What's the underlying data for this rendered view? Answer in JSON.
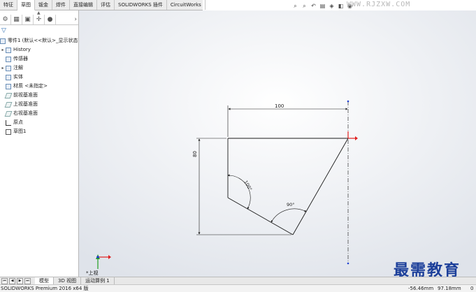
{
  "command_tabs": [
    "特征",
    "草图",
    "钣金",
    "焊件",
    "直接编辑",
    "评估",
    "SOLIDWORKS 插件",
    "CircuitWorks"
  ],
  "active_command_tab": "草图",
  "watermark_top": "WWW.RJZXW.COM",
  "feature_tree": {
    "root": "零件1 (默认<<默认>_显示状态",
    "items": [
      {
        "label": "History",
        "icon": "history-icon",
        "expandable": true
      },
      {
        "label": "传感器",
        "icon": "sensor-icon",
        "expandable": false
      },
      {
        "label": "注解",
        "icon": "annotation-icon",
        "expandable": true
      },
      {
        "label": "实体",
        "icon": "solid-body-icon",
        "expandable": false
      },
      {
        "label": "材质 <未指定>",
        "icon": "material-icon",
        "expandable": false
      },
      {
        "label": "前视基准面",
        "icon": "plane-icon",
        "expandable": false
      },
      {
        "label": "上视基准面",
        "icon": "plane-icon",
        "expandable": false
      },
      {
        "label": "右视基准面",
        "icon": "plane-icon",
        "expandable": false
      },
      {
        "label": "原点",
        "icon": "origin-icon",
        "expandable": false
      },
      {
        "label": "草图1",
        "icon": "sketch-icon",
        "expandable": false
      }
    ]
  },
  "sketch": {
    "dim_horizontal": "100",
    "dim_vertical": "80",
    "angle_1": "100°",
    "angle_2": "90°"
  },
  "view_label": "*上视",
  "bottom_tabs": [
    "模型",
    "3D 视图",
    "运动算例 1"
  ],
  "active_bottom_tab": "模型",
  "status": {
    "product": "SOLIDWORKS Premium 2016 x64 版",
    "x": "-56.46mm",
    "y": "97.18mm",
    "z": "0"
  },
  "brand_watermark": "最需教育",
  "colors": {
    "dimension": "#1a1a1a",
    "axis_red": "#e02020",
    "axis_green": "#20a020",
    "axis_blue": "#2040d0",
    "brand": "#1c3f9a"
  }
}
